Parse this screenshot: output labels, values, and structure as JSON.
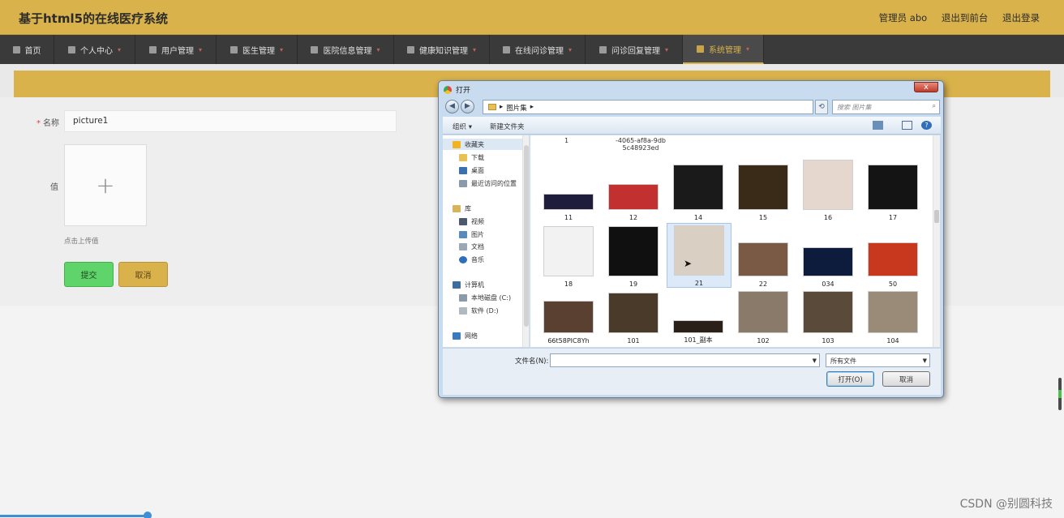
{
  "header": {
    "title": "基于html5的在线医疗系统",
    "user_label": "管理员 abo",
    "front_link": "退出到前台",
    "logout_link": "退出登录"
  },
  "nav": {
    "items": [
      {
        "label": "首页",
        "icon": "home-icon"
      },
      {
        "label": "个人中心",
        "icon": "user-icon"
      },
      {
        "label": "用户管理",
        "icon": "users-icon"
      },
      {
        "label": "医生管理",
        "icon": "flag-icon"
      },
      {
        "label": "医院信息管理",
        "icon": "monitor-icon"
      },
      {
        "label": "健康知识管理",
        "icon": "gear-icon"
      },
      {
        "label": "在线问诊管理",
        "icon": "calendar-icon"
      },
      {
        "label": "问诊回复管理",
        "icon": "chart-icon"
      },
      {
        "label": "系统管理",
        "icon": "navigation-icon"
      }
    ],
    "active_index": 8,
    "accent": "#d9b24c"
  },
  "form": {
    "name_label": "名称",
    "name_value": "picture1",
    "value_label": "值",
    "upload_hint": "点击上传值",
    "submit_label": "提交",
    "cancel_label": "取消"
  },
  "dialog": {
    "title": "打开",
    "close_label": "x",
    "path": "图片集",
    "search_placeholder": "搜索 图片集",
    "toolbar": {
      "organize": "组织 ▾",
      "new_folder": "新建文件夹"
    },
    "sidebar": {
      "favorites": "收藏夹",
      "downloads": "下载",
      "desktop": "桌面",
      "recent": "最近访问的位置",
      "libraries": "库",
      "videos": "视频",
      "pictures": "图片",
      "documents": "文档",
      "music": "音乐",
      "computer": "计算机",
      "drive_c": "本地磁盘 (C:)",
      "drive_d": "软件 (D:)",
      "network": "网络"
    },
    "top_partial": {
      "file1": "1",
      "file2_line1": "-4065-af8a-9db",
      "file2_line2": "5c48923ed"
    },
    "files": [
      {
        "name": "11",
        "tone": "#1e1e3c"
      },
      {
        "name": "12",
        "tone": "#c23030"
      },
      {
        "name": "14",
        "tone": "#1a1a1a"
      },
      {
        "name": "15",
        "tone": "#3a2a18"
      },
      {
        "name": "16",
        "tone": "#e6d7ce"
      },
      {
        "name": "17",
        "tone": "#141414"
      },
      {
        "name": "18",
        "tone": "#f2f2f2"
      },
      {
        "name": "19",
        "tone": "#101010"
      },
      {
        "name": "21",
        "tone": "#d9cfc2"
      },
      {
        "name": "22",
        "tone": "#7a5a44"
      },
      {
        "name": "034",
        "tone": "#0d1c3c"
      },
      {
        "name": "50",
        "tone": "#c8381e"
      },
      {
        "name": "66t58PIC8Yh",
        "tone": "#5a4030"
      },
      {
        "name": "101",
        "tone": "#4a3a2a"
      },
      {
        "name": "101_副本",
        "tone": "#2a2018"
      },
      {
        "name": "102",
        "tone": "#8a7a6a"
      },
      {
        "name": "103",
        "tone": "#5a4a3a"
      },
      {
        "name": "104",
        "tone": "#9a8a78"
      }
    ],
    "selected_file": "21",
    "filename_label": "文件名(N):",
    "filename_value": "",
    "filter_value": "所有文件",
    "open_label": "打开(O)",
    "cancel_label": "取消"
  },
  "watermark": "CSDN @别圆科技"
}
